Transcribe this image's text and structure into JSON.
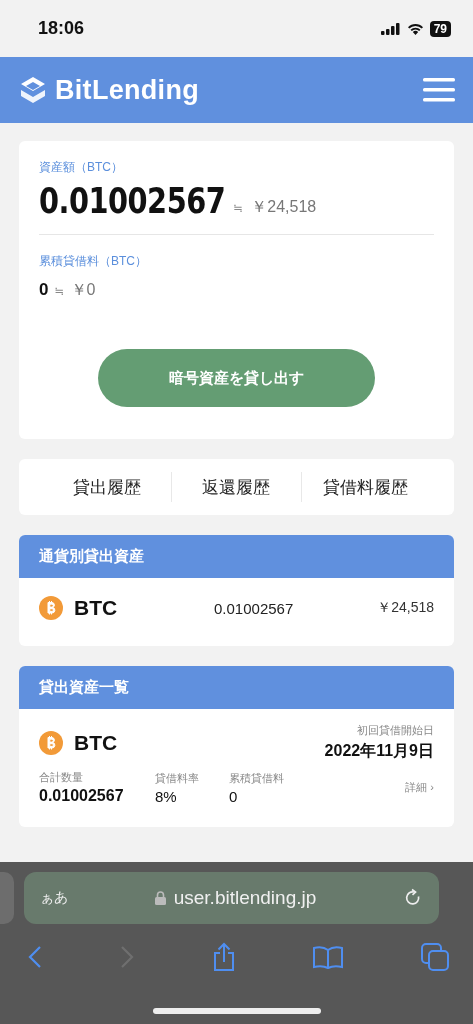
{
  "status_bar": {
    "time": "18:06",
    "battery": "79"
  },
  "header": {
    "logo": "BitLending"
  },
  "summary": {
    "asset_label": "資産額（BTC）",
    "asset_value": "0.01002567",
    "approx": "≒",
    "asset_yen": "￥24,518",
    "fee_label": "累積貸借料（BTC）",
    "fee_value": "0",
    "fee_yen": "￥0",
    "action": "暗号資産を貸し出す"
  },
  "history_tabs": [
    {
      "label": "貸出履歴"
    },
    {
      "label": "返還履歴"
    },
    {
      "label": "貸借料履歴"
    }
  ],
  "by_currency": {
    "title": "通貨別貸出資産",
    "rows": [
      {
        "coin": "BTC",
        "amount": "0.01002567",
        "yen": "￥24,518"
      }
    ]
  },
  "lent_list": {
    "title": "貸出資産一覧",
    "items": [
      {
        "coin": "BTC",
        "start_label": "初回貸借開始日",
        "start_date": "2022年11月9日",
        "total_label": "合計数量",
        "total": "0.01002567",
        "rate_label": "貸借料率",
        "rate": "8%",
        "fee_label": "累積貸借料",
        "fee": "0",
        "detail": "詳細 ›"
      }
    ]
  },
  "browser": {
    "text_size": "ぁあ",
    "url": "user.bitlending.jp",
    "toolbar": [
      {
        "kind": "back",
        "disabled": false
      },
      {
        "kind": "forward",
        "disabled": true
      },
      {
        "kind": "share",
        "disabled": false
      },
      {
        "kind": "bookmarks",
        "disabled": false
      },
      {
        "kind": "tabs",
        "disabled": false
      }
    ]
  }
}
